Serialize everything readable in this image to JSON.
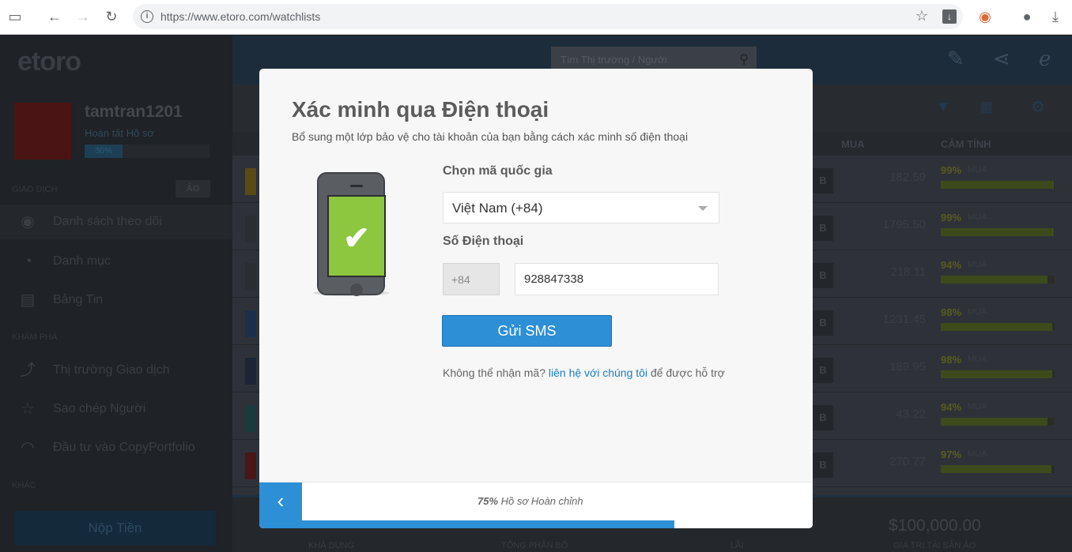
{
  "browser": {
    "url": "https://www.etoro.com/watchlists"
  },
  "sidebar": {
    "logo": "etoro",
    "username": "tamtran1201",
    "profile_complete": "Hoàn tất Hồ sơ",
    "profile_pct": "30%",
    "section_trade": "GIAO DỊCH",
    "mode": "ẢO",
    "items": [
      {
        "label": "Danh sách theo dõi",
        "icon": "eye-icon"
      },
      {
        "label": "Danh mục",
        "icon": "pie-chart-icon"
      },
      {
        "label": "Bảng Tin",
        "icon": "news-icon"
      }
    ],
    "section_explore": "KHÁM PHÁ",
    "explore_items": [
      {
        "label": "Thị trường Giao dịch",
        "icon": "trend-icon"
      },
      {
        "label": "Sao chép Người",
        "icon": "star-icon"
      },
      {
        "label": "Đầu tư vào CopyPortfolio",
        "icon": "gauge-icon"
      }
    ],
    "section_other": "KHÁC",
    "deposit": "Nộp Tiền"
  },
  "topbar": {
    "search_placeholder": "Tìm Thị trường / Người"
  },
  "table": {
    "col_buy": "MUA",
    "col_sentiment": "CẢM TÍNH",
    "buy_btn": "B",
    "rows": [
      {
        "price": "182.59",
        "sentiment": "99%",
        "mua": "MUA",
        "fill": 99,
        "color": "#5a4a14"
      },
      {
        "price": "1795.50",
        "sentiment": "99%",
        "mua": "MUA",
        "fill": 99,
        "color": "#2a2d31"
      },
      {
        "price": "218.11",
        "sentiment": "94%",
        "mua": "MUA",
        "fill": 94,
        "color": "#2a2d31"
      },
      {
        "price": "1231.45",
        "sentiment": "98%",
        "mua": "MUA",
        "fill": 98,
        "color": "#1c2f4a"
      },
      {
        "price": "189.95",
        "sentiment": "98%",
        "mua": "MUA",
        "fill": 98,
        "color": "#1c2436"
      },
      {
        "price": "43.22",
        "sentiment": "94%",
        "mua": "MUA",
        "fill": 94,
        "color": "#1a3a3e"
      },
      {
        "price": "270.77",
        "sentiment": "97%",
        "mua": "MUA",
        "fill": 97,
        "color": "#4a1616"
      }
    ]
  },
  "footer": {
    "available": "KHẢ DỤNG",
    "allocated": "TỔNG PHÂN BỔ",
    "profit": "LÃI",
    "equity_value": "$100,000.00",
    "equity_label": "GIÁ TRỊ TÀI SẢN ẢO"
  },
  "modal": {
    "title": "Xác minh qua Điện thoại",
    "subtitle": "Bổ sung một lớp bảo vệ cho tài khoản của bạn bằng cách xác minh số điện thoại",
    "country_label": "Chọn mã quốc gia",
    "country_value": "Việt Nam (+84)",
    "phone_label": "Số Điện thoại",
    "prefix": "+84",
    "phone_value": "928847338",
    "send_button": "Gửi SMS",
    "help_prefix": "Không thể nhận mã?",
    "help_link": "liên hệ với chúng tôi",
    "help_suffix": "để được hỗ trợ",
    "progress_pct": "75%",
    "progress_text": "Hồ sơ Hoàn chỉnh",
    "progress_value": 75
  }
}
